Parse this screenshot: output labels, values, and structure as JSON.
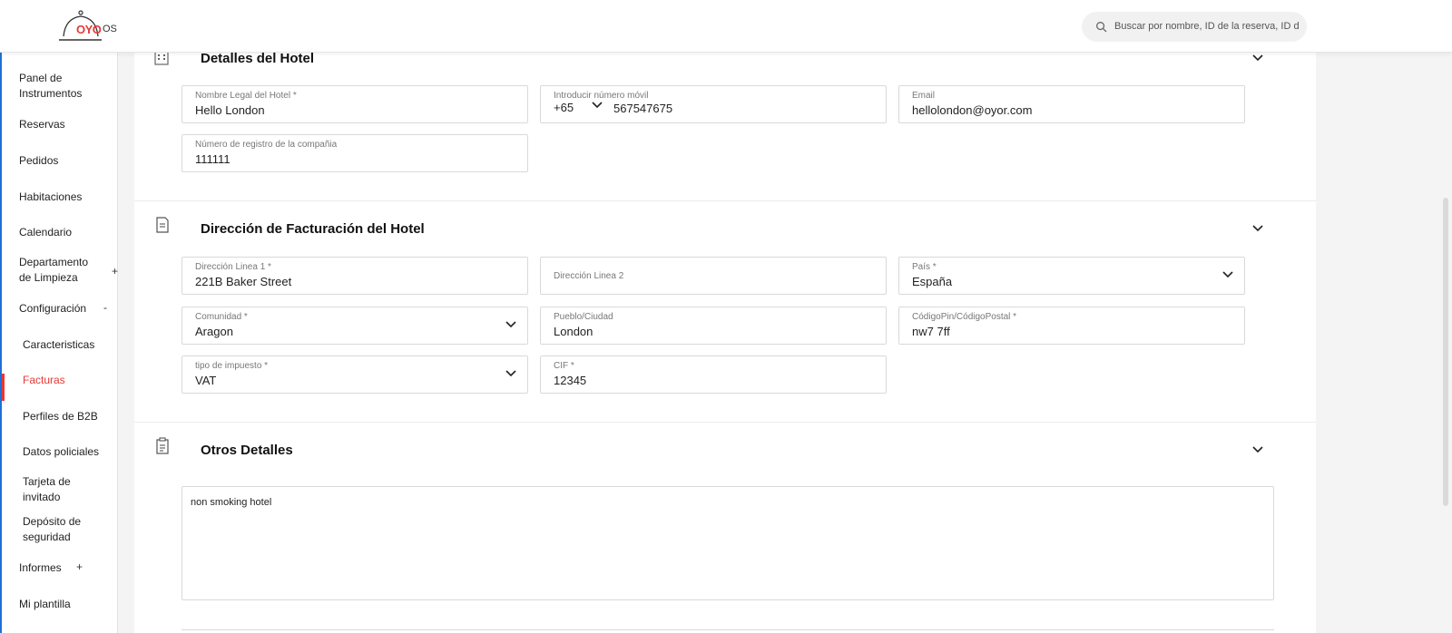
{
  "header": {
    "brand": "OYO",
    "brand_suffix": "OS",
    "search_placeholder": "Buscar por nombre, ID de la reserva, ID de"
  },
  "sidebar": {
    "items": [
      {
        "label": "Panel de Instrumentos"
      },
      {
        "label": "Reservas"
      },
      {
        "label": "Pedidos"
      },
      {
        "label": "Habitaciones"
      },
      {
        "label": "Calendario"
      },
      {
        "label": "Departamento de Limpieza",
        "toggle": "+"
      },
      {
        "label": "Configuración",
        "toggle": "-"
      },
      {
        "label": "Caracteristicas"
      },
      {
        "label": "Facturas",
        "active": true
      },
      {
        "label": "Perfiles de B2B"
      },
      {
        "label": "Datos policiales"
      },
      {
        "label": "Tarjeta de invitado"
      },
      {
        "label": "Depósito de seguridad"
      },
      {
        "label": "Informes",
        "toggle": "+"
      },
      {
        "label": "Mi plantilla"
      }
    ]
  },
  "hotel_details": {
    "title": "Detalles del Hotel",
    "legal_name_label": "Nombre Legal del Hotel *",
    "legal_name_value": "Hello London",
    "mobile_label": "Introducir número móvil",
    "mobile_code": "+65",
    "mobile_number": "567547675",
    "email_label": "Email",
    "email_value": "hellolondon@oyor.com",
    "company_reg_label": "Número de registro de la compañia",
    "company_reg_value": "111111"
  },
  "billing_address": {
    "title": "Dirección de Facturación del Hotel",
    "line1_label": "Dirección Linea 1 *",
    "line1_value": "221B Baker Street",
    "line2_label": "Dirección Linea 2",
    "country_label": "País *",
    "country_value": "España",
    "community_label": "Comunidad *",
    "community_value": "Aragon",
    "city_label": "Pueblo/Ciudad",
    "city_value": "London",
    "postal_label": "CódigoPin/CódigoPostal *",
    "postal_value": "nw7 7ff",
    "tax_type_label": "tipo de impuesto *",
    "tax_type_value": "VAT",
    "cif_label": "CIF *",
    "cif_value": "12345"
  },
  "other_details": {
    "title": "Otros Detalles",
    "notes_value": "non smoking hotel"
  },
  "colors": {
    "accent": "#e53935",
    "sidebar_edge": "#1f6fd6"
  }
}
